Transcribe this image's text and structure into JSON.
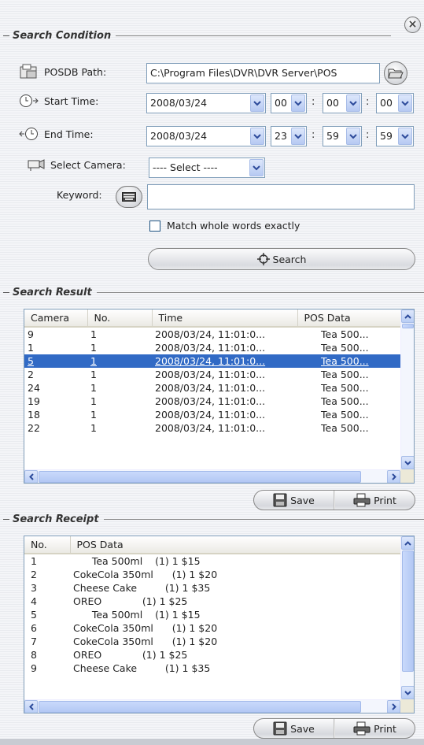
{
  "search_condition": {
    "title": "Search Condition",
    "posdb_label": "POSDB Path:",
    "posdb_value": "C:\\Program Files\\DVR\\DVR Server\\POS",
    "start_label": "Start Time:",
    "start_date": "2008/03/24",
    "start_hour": "00",
    "start_min": "00",
    "start_sec": "00",
    "end_label": "End Time:",
    "end_date": "2008/03/24",
    "end_hour": "23",
    "end_min": "59",
    "end_sec": "59",
    "colon": ":",
    "camera_label": "Select Camera:",
    "camera_value": "---- Select ----",
    "keyword_label": "Keyword:",
    "keyword_value": "",
    "match_label": "Match whole words exactly",
    "match_checked": false,
    "search_label": "Search"
  },
  "search_result": {
    "title": "Search Result",
    "columns": [
      "Camera",
      "No.",
      "Time",
      "POS Data"
    ],
    "rows": [
      [
        "9",
        "1",
        "2008/03/24, 11:01:0...",
        "Tea 500..."
      ],
      [
        "1",
        "1",
        "2008/03/24, 11:01:0...",
        "Tea 500..."
      ],
      [
        "5",
        "1",
        "2008/03/24, 11:01:0...",
        "Tea 500..."
      ],
      [
        "2",
        "1",
        "2008/03/24, 11:01:0...",
        "Tea 500..."
      ],
      [
        "24",
        "1",
        "2008/03/24, 11:01:0...",
        "Tea 500..."
      ],
      [
        "19",
        "1",
        "2008/03/24, 11:01:0...",
        "Tea 500..."
      ],
      [
        "18",
        "1",
        "2008/03/24, 11:01:0...",
        "Tea 500..."
      ],
      [
        "22",
        "1",
        "2008/03/24, 11:01:0...",
        "Tea 500..."
      ]
    ],
    "selected_index": 2,
    "save_label": "Save",
    "print_label": "Print"
  },
  "search_receipt": {
    "title": "Search Receipt",
    "columns": [
      "No.",
      "POS Data"
    ],
    "rows": [
      [
        "1",
        "      Tea 500ml    (1) 1 $15"
      ],
      [
        "2",
        "CokeCola 350ml      (1) 1 $20"
      ],
      [
        "3",
        "Cheese Cake         (1) 1 $35"
      ],
      [
        "4",
        "OREO             (1) 1 $25"
      ],
      [
        "5",
        "      Tea 500ml    (1) 1 $15"
      ],
      [
        "6",
        "CokeCola 350ml      (1) 1 $20"
      ],
      [
        "7",
        "CokeCola 350ml      (1) 1 $20"
      ],
      [
        "8",
        "OREO             (1) 1 $25"
      ],
      [
        "9",
        "Cheese Cake         (1) 1 $35"
      ]
    ],
    "save_label": "Save",
    "print_label": "Print"
  },
  "icons": {
    "close": "close-icon",
    "folder": "folder-icon",
    "start": "clock-start-icon",
    "end": "clock-end-icon",
    "camera": "camera-icon",
    "keyboard": "keyboard-icon",
    "search": "crosshair-icon",
    "save": "floppy-disk-icon",
    "print": "printer-icon"
  },
  "colors": {
    "selection": "#316ac5",
    "field_border": "#7f9db9",
    "scroll_accent": "#b9cdf5"
  }
}
